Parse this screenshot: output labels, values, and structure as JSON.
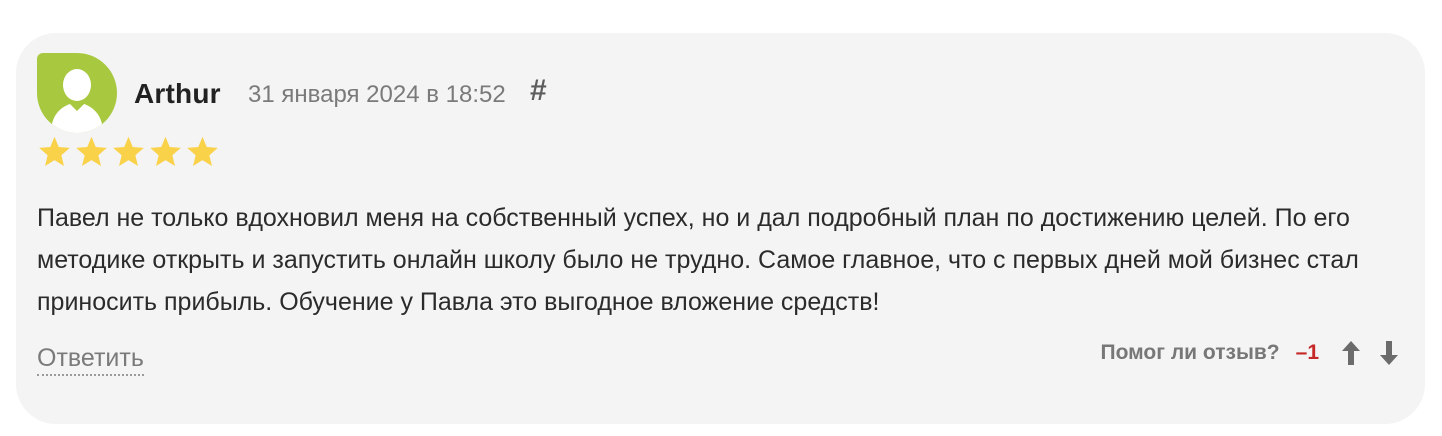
{
  "review": {
    "author": "Arthur",
    "date": "31 января 2024 в 18:52",
    "permalink_symbol": "#",
    "rating": 5,
    "text": "Павел не только вдохновил меня на собственный успех, но и дал подробный план по достижению целей. По его методике открыть и запустить онлайн школу было не трудно. Самое главное, что с первых дней мой бизнес стал приносить прибыль. Обучение у Павла это выгодное вложение средств!",
    "reply_label": "Ответить",
    "helpful_question": "Помог ли отзыв?",
    "helpful_score": "–1"
  },
  "icons": {
    "avatar": "user-silhouette-icon",
    "star": "star-icon",
    "vote_up": "arrow-up-icon",
    "vote_down": "arrow-down-icon"
  },
  "colors": {
    "avatar_bg": "#a7c83f",
    "star": "#f9d24a",
    "score_negative": "#c62828",
    "card_bg": "#f4f4f4"
  }
}
